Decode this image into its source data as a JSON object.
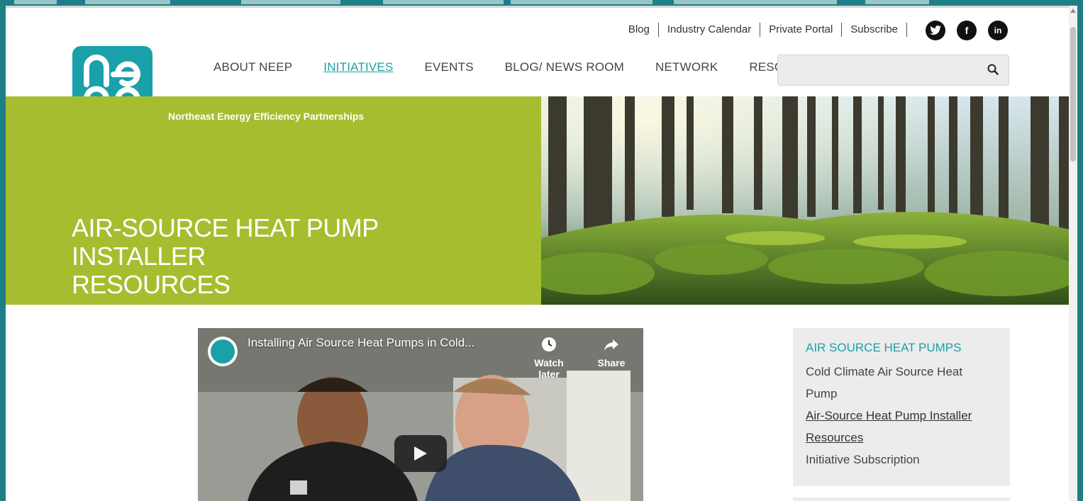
{
  "utility_nav": {
    "links": [
      "Blog",
      "Industry Calendar",
      "Private Portal",
      "Subscribe"
    ],
    "social": [
      {
        "icon": "twitter-icon",
        "glyph": "t"
      },
      {
        "icon": "facebook-icon",
        "glyph": "f"
      },
      {
        "icon": "linkedin-icon",
        "glyph": "in"
      }
    ]
  },
  "logo": {
    "tagline": "Northeast Energy Efficiency Partnerships"
  },
  "main_nav": {
    "items": [
      "ABOUT NEEP",
      "INITIATIVES",
      "EVENTS",
      "BLOG/ NEWS ROOM",
      "NETWORK",
      "RESOURCES"
    ],
    "active": "INITIATIVES"
  },
  "search": {
    "value": "",
    "placeholder": ""
  },
  "hero": {
    "title_line1": "AIR-SOURCE HEAT PUMP INSTALLER",
    "title_line2": "RESOURCES"
  },
  "video": {
    "title": "Installing Air Source Heat Pumps in Cold...",
    "watch_later": "Watch later",
    "share": "Share"
  },
  "sidebar": {
    "heading": "AIR SOURCE HEAT PUMPS",
    "items": [
      "Cold Climate Air Source Heat",
      "Pump",
      "Air-Source Heat Pump Installer",
      "Resources",
      "Initiative Subscription"
    ]
  },
  "colors": {
    "brand_teal": "#1aa0a8",
    "hero_green": "#a6bd2f",
    "frame": "#1e7f86"
  }
}
